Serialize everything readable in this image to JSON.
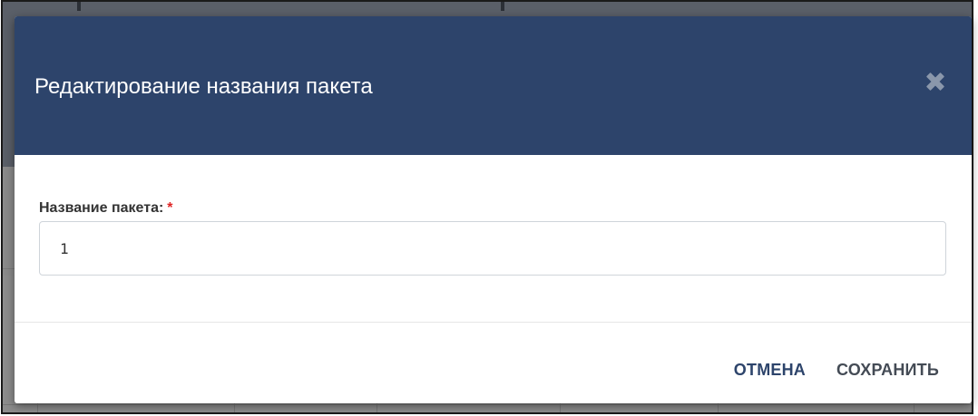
{
  "dialog": {
    "title": "Редактирование названия пакета",
    "close_icon": "close-x-icon"
  },
  "form": {
    "package_name": {
      "label": "Название пакета:",
      "required_marker": "*",
      "value": "1"
    }
  },
  "footer": {
    "cancel_label": "ОТМЕНА",
    "save_label": "СОХРАНИТЬ"
  },
  "colors": {
    "header_bg": "#2d446b",
    "cancel_text": "#2d446b",
    "save_text": "#444b55",
    "required": "#e02424",
    "overlay": "#5a5f68"
  }
}
